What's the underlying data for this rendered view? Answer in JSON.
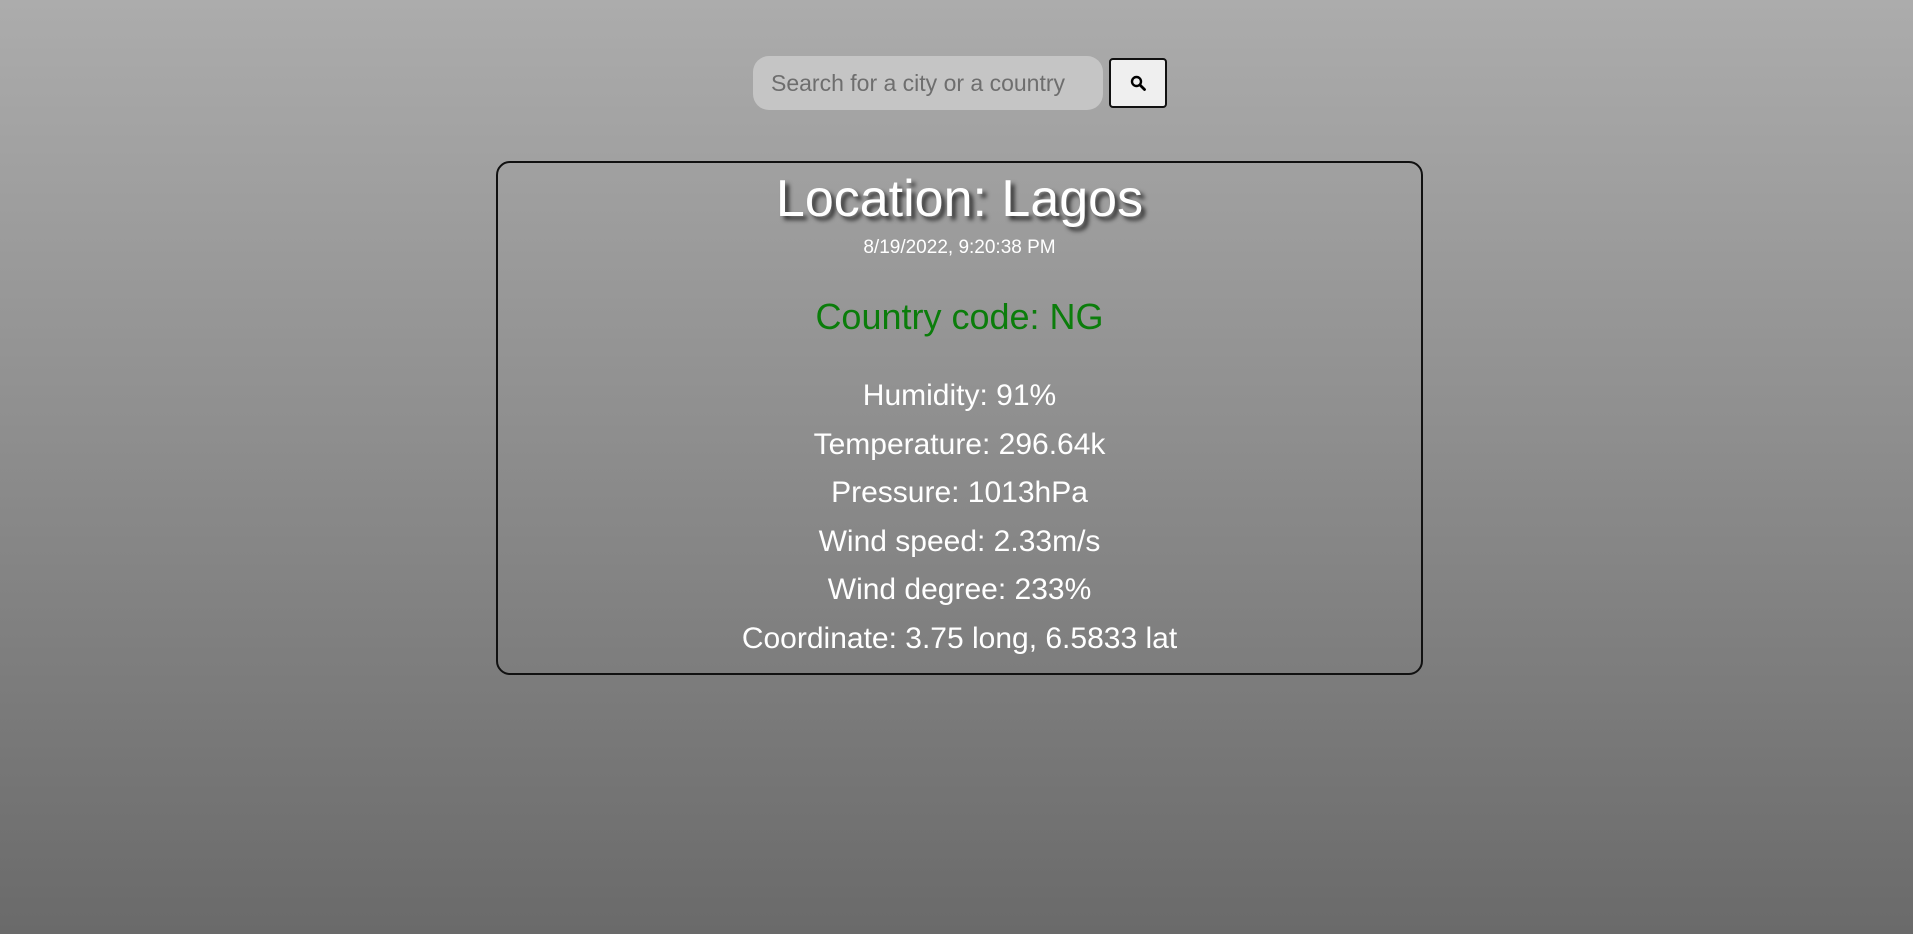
{
  "search": {
    "placeholder": "Search for a city or a country"
  },
  "icons": {
    "search_button_icon": "search-icon"
  },
  "weather": {
    "location_title": "Location: Lagos",
    "datetime": "8/19/2022, 9:20:38 PM",
    "country_code": "Country code: NG",
    "humidity": "Humidity: 91%",
    "temperature": "Temperature: 296.64k",
    "pressure": "Pressure: 1013hPa",
    "wind_speed": "Wind speed: 2.33m/s",
    "wind_degree": "Wind degree: 233%",
    "coordinate": "Coordinate: 3.75 long, 6.5833 lat"
  },
  "colors": {
    "country_code": "#0b7d0b",
    "text": "#ffffff",
    "search_input_bg": "#c5c5c5",
    "card_border": "#111111"
  }
}
